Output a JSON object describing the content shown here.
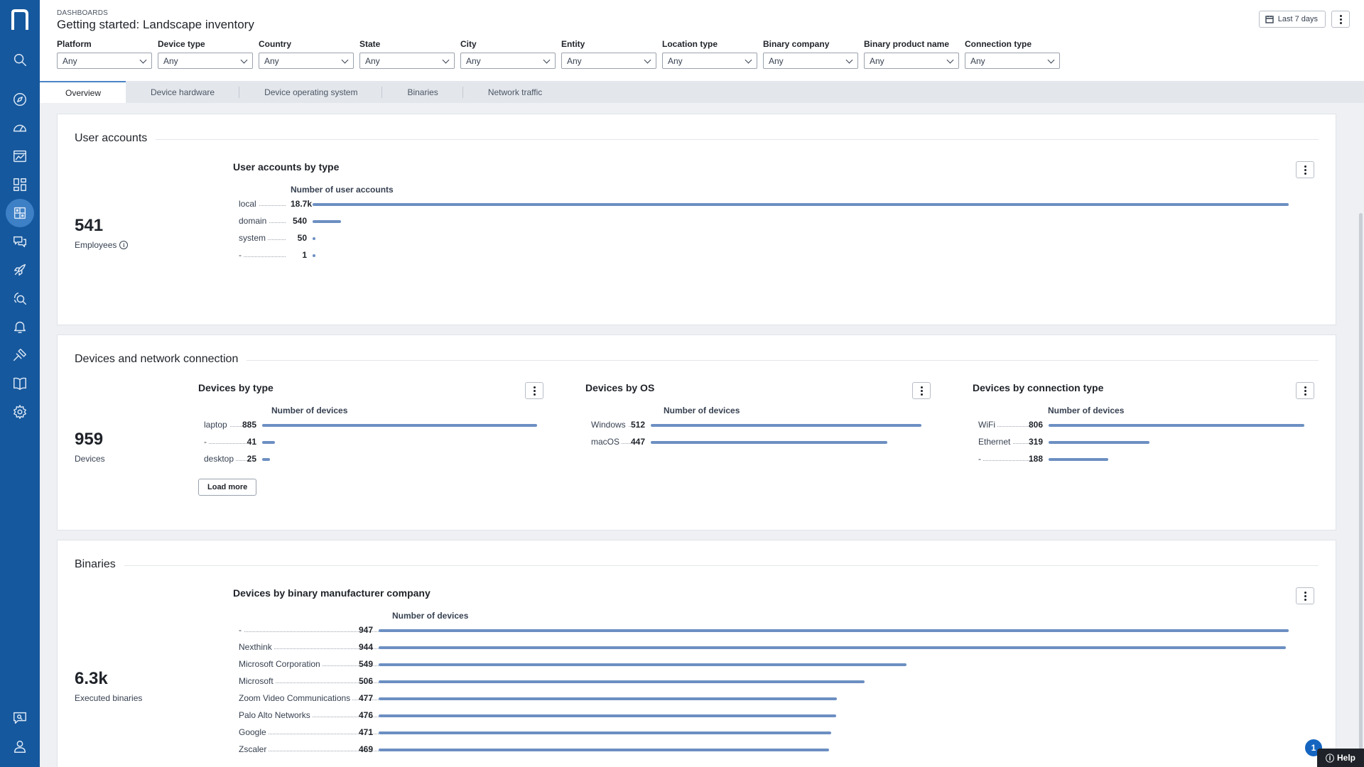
{
  "sidebar": {
    "items": [
      {
        "icon": "search-icon"
      },
      {
        "icon": "compass-icon"
      },
      {
        "icon": "gauge-icon"
      },
      {
        "icon": "chart-window-icon"
      },
      {
        "icon": "dashboard-grid-icon"
      },
      {
        "icon": "dashboards-icon",
        "active": true
      },
      {
        "icon": "chat-bubbles-icon"
      },
      {
        "icon": "rocket-icon"
      },
      {
        "icon": "investigation-icon"
      },
      {
        "icon": "bell-icon"
      },
      {
        "icon": "remote-actions-icon"
      },
      {
        "icon": "library-book-icon"
      },
      {
        "icon": "gear-icon"
      }
    ],
    "bottom": [
      {
        "icon": "feedback-search-icon"
      },
      {
        "icon": "user-icon"
      }
    ]
  },
  "header": {
    "breadcrumb": "DASHBOARDS",
    "title": "Getting started: Landscape inventory",
    "date_range": "Last 7 days"
  },
  "filters": [
    {
      "label": "Platform",
      "value": "Any"
    },
    {
      "label": "Device type",
      "value": "Any"
    },
    {
      "label": "Country",
      "value": "Any"
    },
    {
      "label": "State",
      "value": "Any"
    },
    {
      "label": "City",
      "value": "Any"
    },
    {
      "label": "Entity",
      "value": "Any"
    },
    {
      "label": "Location type",
      "value": "Any"
    },
    {
      "label": "Binary company",
      "value": "Any"
    },
    {
      "label": "Binary product name",
      "value": "Any"
    },
    {
      "label": "Connection type",
      "value": "Any"
    }
  ],
  "tabs": [
    {
      "label": "Overview",
      "active": true
    },
    {
      "label": "Device hardware"
    },
    {
      "label": "Device operating system"
    },
    {
      "label": "Binaries"
    },
    {
      "label": "Network traffic"
    }
  ],
  "sections": {
    "user_accounts": {
      "title": "User accounts",
      "kpi_value": "541",
      "kpi_label": "Employees",
      "widget_title": "User accounts by type"
    },
    "devices": {
      "title": "Devices and network connection",
      "kpi_value": "959",
      "kpi_label": "Devices",
      "load_more": "Load more",
      "w1_title": "Devices by type",
      "w2_title": "Devices by OS",
      "w3_title": "Devices by connection type"
    },
    "binaries": {
      "title": "Binaries",
      "kpi_value": "6.3k",
      "kpi_label": "Executed binaries",
      "widget_title": "Devices by binary manufacturer company"
    }
  },
  "help": {
    "label": "Help",
    "badge": "1"
  },
  "colors": {
    "sidebar": "#16589d",
    "bar": "#6c8fc2",
    "accent": "#4a84c6"
  },
  "chart_data": [
    {
      "type": "bar",
      "title": "User accounts by type",
      "xlabel": "Number of user accounts",
      "categories": [
        "local",
        "domain",
        "system",
        "-"
      ],
      "values": [
        18700,
        540,
        50,
        1
      ],
      "value_labels": [
        "18.7k",
        "540",
        "50",
        "1"
      ]
    },
    {
      "type": "bar",
      "title": "Devices by type",
      "xlabel": "Number of devices",
      "categories": [
        "laptop",
        "-",
        "desktop"
      ],
      "values": [
        885,
        41,
        25
      ],
      "value_labels": [
        "885",
        "41",
        "25"
      ]
    },
    {
      "type": "bar",
      "title": "Devices by OS",
      "xlabel": "Number of devices",
      "categories": [
        "Windows",
        "macOS"
      ],
      "values": [
        512,
        447
      ],
      "value_labels": [
        "512",
        "447"
      ]
    },
    {
      "type": "bar",
      "title": "Devices by connection type",
      "xlabel": "Number of devices",
      "categories": [
        "WiFi",
        "Ethernet",
        "-"
      ],
      "values": [
        806,
        319,
        188
      ],
      "value_labels": [
        "806",
        "319",
        "188"
      ]
    },
    {
      "type": "bar",
      "title": "Devices by binary manufacturer company",
      "xlabel": "Number of devices",
      "categories": [
        "-",
        "Nexthink",
        "Microsoft Corporation",
        "Microsoft",
        "Zoom Video Communications",
        "Palo Alto Networks",
        "Google",
        "Zscaler"
      ],
      "values": [
        947,
        944,
        549,
        506,
        477,
        476,
        471,
        469
      ],
      "value_labels": [
        "947",
        "944",
        "549",
        "506",
        "477",
        "476",
        "471",
        "469"
      ]
    }
  ]
}
